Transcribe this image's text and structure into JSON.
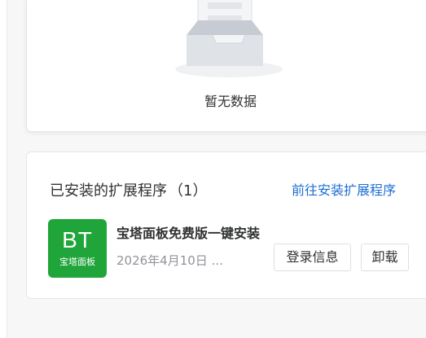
{
  "empty_state": {
    "text": "暂无数据",
    "icon": "empty-inbox-icon"
  },
  "installed": {
    "title": "已安装的扩展程序",
    "count": "（1）",
    "goto_link": "前往安装扩展程序",
    "items": [
      {
        "logo_main": "BT",
        "logo_sub": "宝塔面板",
        "logo_color": "#20a53a",
        "name": "宝塔面板免费版一键安装",
        "date": "2026年4月10日 ...",
        "login_label": "登录信息",
        "uninstall_label": "卸载"
      }
    ]
  },
  "colors": {
    "accent_link": "#1e6fd0",
    "brand_green": "#20a53a"
  }
}
